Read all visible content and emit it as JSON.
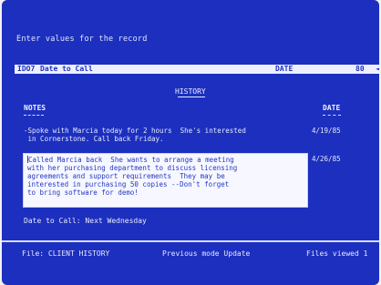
{
  "prompt": "Enter values for the record",
  "field_bar": {
    "key": "IDO7",
    "label": "Date to Call",
    "type": "DATE",
    "end": "80",
    "arrow": "◄"
  },
  "history": {
    "title": "HISTORY"
  },
  "columns": {
    "notes": "NOTES",
    "date": "DATE"
  },
  "notes": [
    {
      "text": "-Spoke with Marcia today for 2 hours  She's interested\n in Cornerstone. Call back Friday.",
      "date": "4/19/85"
    },
    {
      "text": "Called Marcia back  She wants to arrange a meeting\nwith her purchasing department to discuss licensing\nagreements and support requirements  They may be\ninterested in purchasing 50 copies --Don't forget\nto bring software for demo!",
      "date": "4/26/85",
      "editing": true
    }
  ],
  "date_to_call": "Date to Call: Next Wednesday",
  "status_bar": {
    "file": "File: CLIENT HISTORY",
    "mode": "Previous mode  Update",
    "files": "Files viewed  1"
  }
}
